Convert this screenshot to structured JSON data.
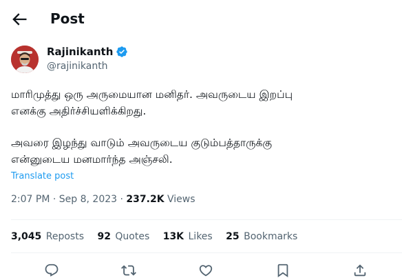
{
  "header": {
    "title": "Post",
    "back_icon": "arrow-left-icon"
  },
  "author": {
    "name": "Rajinikanth",
    "handle": "@rajinikanth",
    "verified_color": "#1d9bf0",
    "avatar_color": "#b8322e"
  },
  "post": {
    "lines": [
      "மாரிமுத்து ஒரு அருமையான மனிதர். அவருடைய இறப்பு",
      "எனக்கு அதிர்ச்சியளிக்கிறது.",
      "அவரை இழந்து வாடும் அவருடைய குடும்பத்தாருக்கு",
      "என்னுடைய மனமார்ந்த அஞ்சலி."
    ],
    "translate_label": "Translate post"
  },
  "meta": {
    "time": "2:07 PM",
    "separator": "·",
    "date": "Sep 8, 2023",
    "views_count": "237.2K",
    "views_label": "Views"
  },
  "stats": {
    "reposts": {
      "count": "3,045",
      "label": "Reposts"
    },
    "quotes": {
      "count": "92",
      "label": "Quotes"
    },
    "likes": {
      "count": "13K",
      "label": "Likes"
    },
    "bookmarks": {
      "count": "25",
      "label": "Bookmarks"
    }
  },
  "actions": [
    "reply-icon",
    "repost-icon",
    "like-icon",
    "bookmark-icon",
    "share-icon"
  ],
  "colors": {
    "text": "#0f1419",
    "secondary": "#536471",
    "link": "#1d9bf0",
    "divider": "#eff3f4"
  }
}
